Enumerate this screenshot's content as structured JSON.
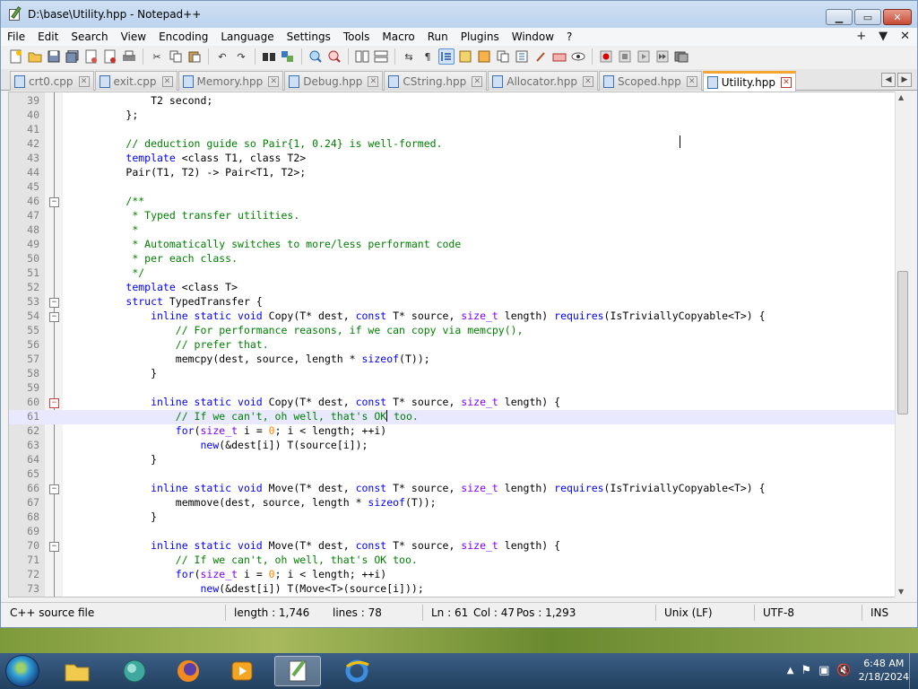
{
  "window": {
    "title": "D:\\base\\Utility.hpp - Notepad++"
  },
  "menu": [
    "File",
    "Edit",
    "Search",
    "View",
    "Encoding",
    "Language",
    "Settings",
    "Tools",
    "Macro",
    "Run",
    "Plugins",
    "Window",
    "?"
  ],
  "menu_right": {
    "plus": "+",
    "down": "▼",
    "close": "✕"
  },
  "tabs": [
    {
      "label": "crt0.cpp",
      "active": false
    },
    {
      "label": "exit.cpp",
      "active": false
    },
    {
      "label": "Memory.hpp",
      "active": false
    },
    {
      "label": "Debug.hpp",
      "active": false
    },
    {
      "label": "CString.hpp",
      "active": false
    },
    {
      "label": "Allocator.hpp",
      "active": false
    },
    {
      "label": "Scoped.hpp",
      "active": false
    },
    {
      "label": "Utility.hpp",
      "active": true
    }
  ],
  "editor": {
    "current_line": "61",
    "lines": [
      {
        "n": "39",
        "fold": ""
      },
      {
        "n": "40",
        "fold": ""
      },
      {
        "n": "41",
        "fold": ""
      },
      {
        "n": "42",
        "fold": ""
      },
      {
        "n": "43",
        "fold": ""
      },
      {
        "n": "44",
        "fold": ""
      },
      {
        "n": "45",
        "fold": ""
      },
      {
        "n": "46",
        "fold": "box"
      },
      {
        "n": "47",
        "fold": ""
      },
      {
        "n": "48",
        "fold": ""
      },
      {
        "n": "49",
        "fold": ""
      },
      {
        "n": "50",
        "fold": ""
      },
      {
        "n": "51",
        "fold": ""
      },
      {
        "n": "52",
        "fold": ""
      },
      {
        "n": "53",
        "fold": "box"
      },
      {
        "n": "54",
        "fold": "box"
      },
      {
        "n": "55",
        "fold": ""
      },
      {
        "n": "56",
        "fold": ""
      },
      {
        "n": "57",
        "fold": ""
      },
      {
        "n": "58",
        "fold": ""
      },
      {
        "n": "59",
        "fold": ""
      },
      {
        "n": "60",
        "fold": "hot"
      },
      {
        "n": "61",
        "fold": ""
      },
      {
        "n": "62",
        "fold": ""
      },
      {
        "n": "63",
        "fold": ""
      },
      {
        "n": "64",
        "fold": ""
      },
      {
        "n": "65",
        "fold": ""
      },
      {
        "n": "66",
        "fold": "box"
      },
      {
        "n": "67",
        "fold": ""
      },
      {
        "n": "68",
        "fold": ""
      },
      {
        "n": "69",
        "fold": ""
      },
      {
        "n": "70",
        "fold": "box"
      },
      {
        "n": "71",
        "fold": ""
      },
      {
        "n": "72",
        "fold": ""
      },
      {
        "n": "73",
        "fold": ""
      }
    ],
    "code": {
      "l39": "T2 second;",
      "l40": "};",
      "l42": "// deduction guide so Pair{1, 0.24} is well-formed.",
      "l43_kw": "template",
      "l43_rest": " <class T1, class T2>",
      "l44": "Pair(T1, T2) -> Pair<T1, T2>;",
      "l46": "/**",
      "l47": " * Typed transfer utilities.",
      "l48": " *",
      "l49": " * Automatically switches to more/less performant code",
      "l50": " * per each class.",
      "l51": " */",
      "l52_kw": "template",
      "l52_rest": " <class T>",
      "l53_kw": "struct",
      "l53_rest": " TypedTransfer {",
      "l54_a": "inline static void",
      "l54_b": " Copy(T* dest, ",
      "l54_c": "const",
      "l54_d": " T* source, ",
      "l54_e": "size_t",
      "l54_f": " length) ",
      "l54_g": "requires",
      "l54_h": "(IsTriviallyCopyable<T>) {",
      "l55": "// For performance reasons, if we can copy via memcpy(),",
      "l56": "// prefer that.",
      "l57_a": "memcpy(dest, source, length * ",
      "l57_b": "sizeof",
      "l57_c": "(T));",
      "l58": "}",
      "l60_a": "inline static void",
      "l60_b": " Copy(T* dest, ",
      "l60_c": "const",
      "l60_d": " T* source, ",
      "l60_e": "size_t",
      "l60_f": " length) {",
      "l61_a": "// If we can't, oh well, that's OK",
      "l61_b": " too.",
      "l62_a": "for",
      "l62_b": "(",
      "l62_c": "size_t",
      "l62_d": " i = ",
      "l62_e": "0",
      "l62_f": "; i < length; ++i)",
      "l63_a": "new",
      "l63_b": "(&dest[i]) T(source[i]);",
      "l64": "}",
      "l66_a": "inline static void",
      "l66_b": " Move(T* dest, ",
      "l66_c": "const",
      "l66_d": " T* source, ",
      "l66_e": "size_t",
      "l66_f": " length) ",
      "l66_g": "requires",
      "l66_h": "(IsTriviallyCopyable<T>) {",
      "l67_a": "memmove(dest, source, length * ",
      "l67_b": "sizeof",
      "l67_c": "(T));",
      "l68": "}",
      "l70_a": "inline static void",
      "l70_b": " Move(T* dest, ",
      "l70_c": "const",
      "l70_d": " T* source, ",
      "l70_e": "size_t",
      "l70_f": " length) {",
      "l71": "// If we can't, oh well, that's OK too.",
      "l72_a": "for",
      "l72_b": "(",
      "l72_c": "size_t",
      "l72_d": " i = ",
      "l72_e": "0",
      "l72_f": "; i < length; ++i)",
      "l73_a": "new",
      "l73_b": "(&dest[i]) T(Move<T>(source[i]));"
    }
  },
  "status": {
    "type": "C++ source file",
    "length": "length : 1,746",
    "lines": "lines : 78",
    "ln": "Ln : 61",
    "col": "Col : 47",
    "pos": "Pos : 1,293",
    "eol": "Unix (LF)",
    "encoding": "UTF-8",
    "mode": "INS"
  },
  "taskbar": {
    "time": "6:48 AM",
    "date": "2/18/2024"
  },
  "colors": {
    "keyword": "#0000ff",
    "type": "#8000ff",
    "comment": "#008000",
    "number": "#ff8000",
    "active_tab_accent": "#f7a531"
  }
}
